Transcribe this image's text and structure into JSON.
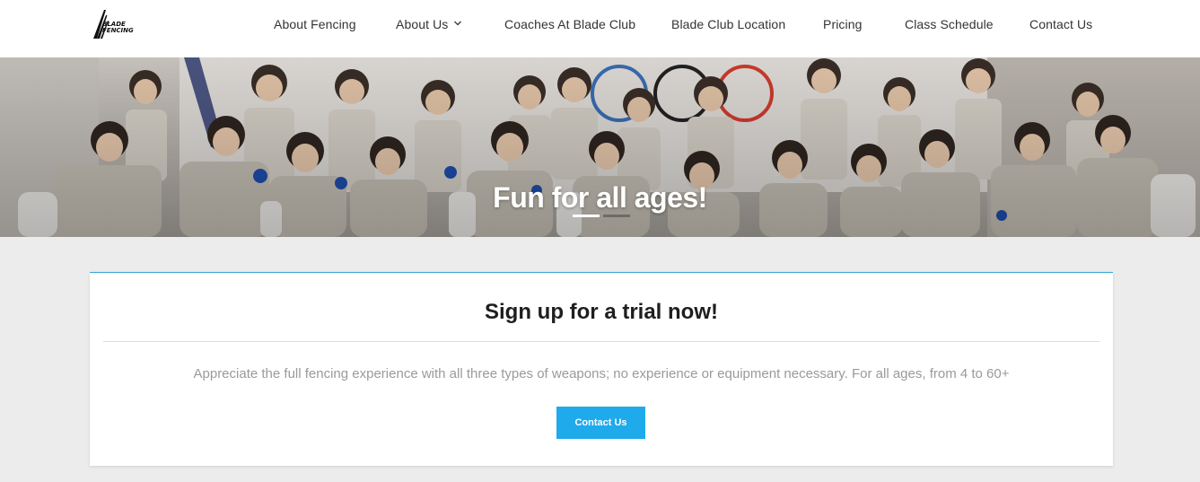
{
  "brand": {
    "logo_line1": "BLADE",
    "logo_line2": "FENCING",
    "logo_icon": "blade-slash-icon"
  },
  "nav": {
    "items": [
      {
        "label": "About Fencing"
      },
      {
        "label": "About Us",
        "has_dropdown": true,
        "icon": "chevron-down-icon"
      },
      {
        "label": "Coaches At Blade Club"
      },
      {
        "label": "Blade Club Location"
      },
      {
        "label": "Pricing"
      },
      {
        "label": "Class Schedule"
      },
      {
        "label": "Contact Us"
      }
    ]
  },
  "hero": {
    "title": "Fun for all ages!",
    "slides_total": 2,
    "active_slide": 1
  },
  "signup": {
    "title": "Sign up for a trial now!",
    "description": "Appreciate the full fencing experience with all three types of weapons; no experience or equipment necessary. For all ages, from 4 to 60+",
    "button_label": "Contact Us"
  },
  "colors": {
    "accent": "#1faaeb",
    "card_border": "#3aa7d8",
    "page_bg": "#ececec"
  }
}
